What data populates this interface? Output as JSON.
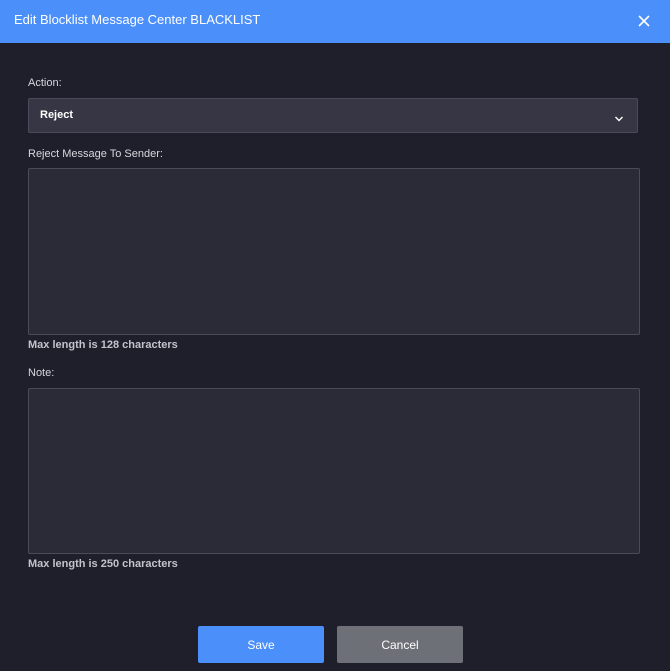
{
  "header": {
    "title": "Edit Blocklist Message Center BLACKLIST",
    "close_icon": "close-icon"
  },
  "action": {
    "label": "Action:",
    "selected": "Reject",
    "icon": "chevron-down-icon"
  },
  "reject_message": {
    "label": "Reject Message To Sender:",
    "value": "",
    "hint": "Max length is 128 characters"
  },
  "note": {
    "label": "Note:",
    "value": "",
    "hint": "Max length is 250 characters"
  },
  "buttons": {
    "save_label": "Save",
    "cancel_label": "Cancel"
  },
  "colors": {
    "header_bg": "#4b8ffb",
    "page_bg": "#1f1f2b",
    "save_bg": "#4b8ffb",
    "cancel_bg": "#6e7078"
  }
}
